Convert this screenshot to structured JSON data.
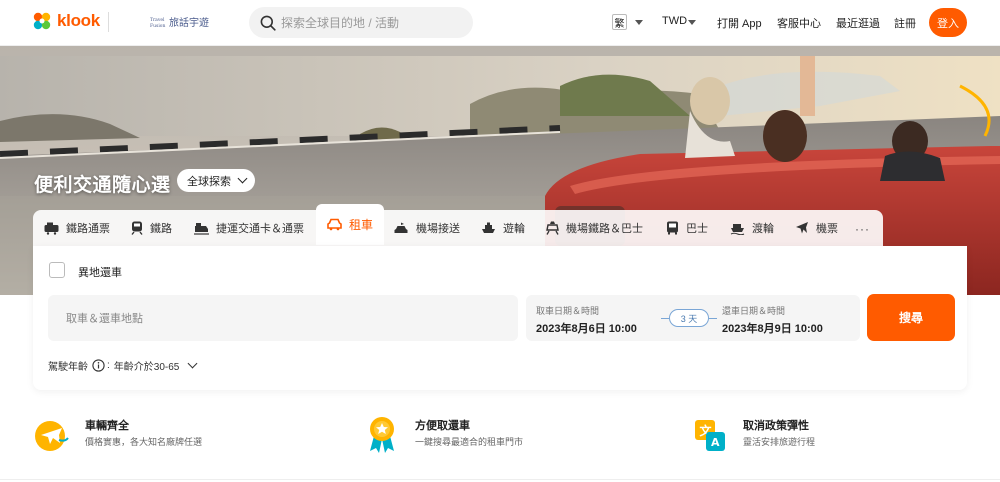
{
  "header": {
    "logo_text": "klook",
    "partner_text": "旅話宇遊",
    "search_placeholder": "探索全球目的地 / 活動",
    "language": "繁",
    "currency": "TWD",
    "open_app": "打開 App",
    "help_center": "客服中心",
    "recently_viewed": "最近逛過",
    "register": "註冊",
    "login": "登入"
  },
  "hero": {
    "title": "便利交通隨心選",
    "explore_label": "全球探索"
  },
  "tabs": [
    {
      "label": "鐵路通票",
      "icon": "rail-pass-icon"
    },
    {
      "label": "鐵路",
      "icon": "train-icon"
    },
    {
      "label": "捷運交通卡＆通票",
      "icon": "metro-card-icon"
    },
    {
      "label": "租車",
      "icon": "car-icon",
      "active": true
    },
    {
      "label": "機場接送",
      "icon": "airport-transfer-icon"
    },
    {
      "label": "遊輪",
      "icon": "cruise-icon"
    },
    {
      "label": "機場鐵路＆巴士",
      "icon": "airport-rail-icon"
    },
    {
      "label": "巴士",
      "icon": "bus-icon"
    },
    {
      "label": "渡輪",
      "icon": "ferry-icon"
    },
    {
      "label": "機票",
      "icon": "plane-icon"
    }
  ],
  "tabs_more": "···",
  "panel": {
    "different_return_label": "異地還車",
    "location_placeholder": "取車＆還車地點",
    "pickup_label": "取車日期＆時間",
    "pickup_value": "2023年8月6日 10:00",
    "days_label": "3 天",
    "return_label": "還車日期＆時間",
    "return_value": "2023年8月9日 10:00",
    "search_label": "搜尋",
    "age_label": "駕駛年齡",
    "age_value": "年齡介於30-65"
  },
  "features": [
    {
      "title": "車輛齊全",
      "desc": "價格實惠，各大知名廠牌任選",
      "icon": "plane-badge-icon"
    },
    {
      "title": "方便取還車",
      "desc": "一鍵搜尋最適合的租車門市",
      "icon": "medal-icon"
    },
    {
      "title": "取消政策彈性",
      "desc": "靈活安排旅遊行程",
      "icon": "translate-icon"
    }
  ],
  "colors": {
    "accent": "#ff5b00"
  }
}
